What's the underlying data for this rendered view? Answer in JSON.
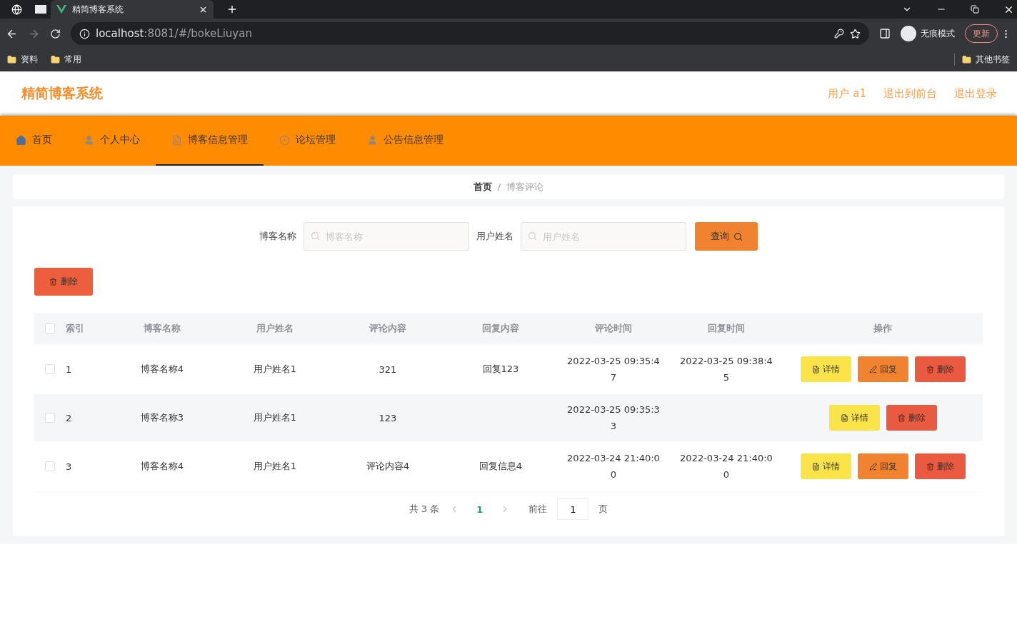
{
  "browser": {
    "tab_title": "精简博客系统",
    "url_host": "localhost",
    "url_rest": ":8081/#/bokeLiuyan",
    "profile": "无痕模式",
    "update": "更新",
    "bookmarks": [
      "资料",
      "常用"
    ],
    "other_bookmarks": "其他书签"
  },
  "header": {
    "title": "精简博客系统",
    "links": [
      "用户 a1",
      "退出到前台",
      "退出登录"
    ]
  },
  "nav": [
    {
      "label": "首页",
      "selected": false
    },
    {
      "label": "个人中心",
      "selected": false
    },
    {
      "label": "博客信息管理",
      "selected": true
    },
    {
      "label": "论坛管理",
      "selected": false
    },
    {
      "label": "公告信息管理",
      "selected": false
    }
  ],
  "breadcrumb": [
    "首页",
    "博客评论"
  ],
  "breadcrumb_separator": "/",
  "search": {
    "fields": [
      {
        "label": "博客名称",
        "placeholder": "博客名称"
      },
      {
        "label": "用户姓名",
        "placeholder": "用户姓名"
      }
    ],
    "button": "查询"
  },
  "bulk_delete": "删除",
  "table": {
    "header_checked": false,
    "columns": [
      "索引",
      "博客名称",
      "用户姓名",
      "评论内容",
      "回复内容",
      "评论时间",
      "回复时间",
      "操作"
    ],
    "rows": [
      {
        "checked": false,
        "cells": [
          "1",
          "博客名称4",
          "用户姓名1",
          "321",
          "回复123",
          "2022-03-25 09:35:47",
          "2022-03-25 09:38:45"
        ],
        "actions": [
          {
            "kind": "detail",
            "label": "详情"
          },
          {
            "kind": "reply",
            "label": "回复"
          },
          {
            "kind": "delete",
            "label": "删除"
          }
        ]
      },
      {
        "checked": false,
        "cells": [
          "2",
          "博客名称3",
          "用户姓名1",
          "123",
          "",
          "2022-03-25 09:35:33",
          ""
        ],
        "actions": [
          {
            "kind": "detail",
            "label": "详情"
          },
          {
            "kind": "delete",
            "label": "删除"
          }
        ]
      },
      {
        "checked": false,
        "cells": [
          "3",
          "博客名称4",
          "用户姓名1",
          "评论内容4",
          "回复信息4",
          "2022-03-24 21:40:00",
          "2022-03-24 21:40:00"
        ],
        "actions": [
          {
            "kind": "detail",
            "label": "详情"
          },
          {
            "kind": "reply",
            "label": "回复"
          },
          {
            "kind": "delete",
            "label": "删除"
          }
        ]
      }
    ]
  },
  "pagination": {
    "total": "共 3 条",
    "pages": [
      {
        "label": "1",
        "selected": true
      }
    ],
    "goto": "前往",
    "page_value": "1",
    "page_suffix": "页"
  }
}
